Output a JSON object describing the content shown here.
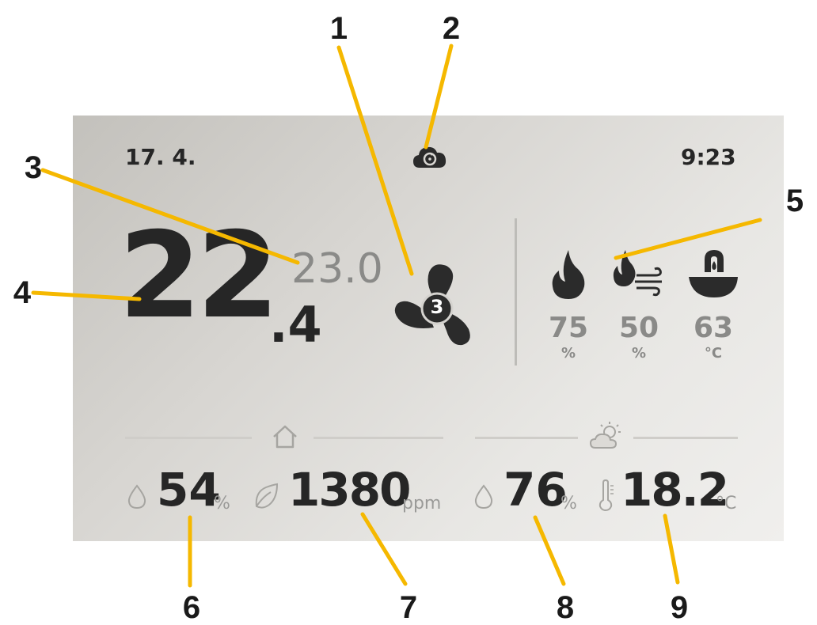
{
  "status_bar": {
    "date": "17. 4.",
    "time": "9:23",
    "cloud_icon": "cloud-sync-icon"
  },
  "temperature": {
    "current_whole": "22",
    "current_decimal": ".4",
    "target": "23.0"
  },
  "fan": {
    "icon": "fan-icon",
    "speed": "3"
  },
  "heating": [
    {
      "icon": "flame-icon",
      "value": "75",
      "unit": "%"
    },
    {
      "icon": "flame-air-icon",
      "value": "50",
      "unit": "%"
    },
    {
      "icon": "hot-water-tap-icon",
      "value": "63",
      "unit": "°C"
    }
  ],
  "indoor": {
    "icon": "house-icon",
    "humidity_value": "54",
    "humidity_unit": "%",
    "humidity_icon": "droplet-icon",
    "co2_value": "1380",
    "co2_unit": "ppm",
    "co2_icon": "leaf-icon"
  },
  "outdoor": {
    "icon": "sun-cloud-icon",
    "humidity_value": "76",
    "humidity_unit": "%",
    "humidity_icon": "droplet-icon",
    "temperature_value": "18.2",
    "temperature_unit": "°C",
    "temperature_icon": "thermometer-icon"
  },
  "callouts": [
    "1",
    "2",
    "3",
    "4",
    "5",
    "6",
    "7",
    "8",
    "9"
  ],
  "colors": {
    "callout_line": "#f5b800",
    "primary_text": "#262626",
    "secondary_text": "#8a8a88"
  }
}
